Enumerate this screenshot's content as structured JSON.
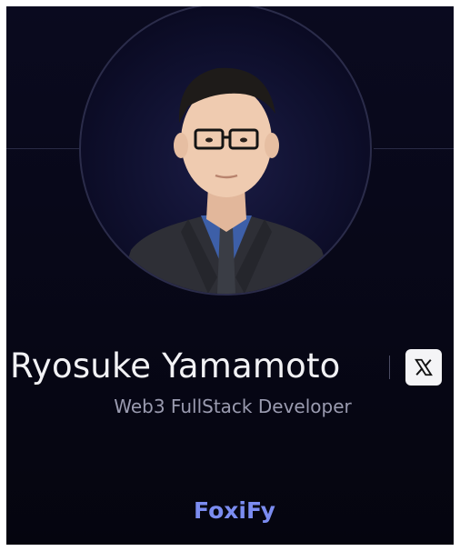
{
  "profile": {
    "name": "Ryosuke Yamamoto",
    "role": "Web3 FullStack Developer",
    "social_icon": "x-logo-icon"
  },
  "brand": {
    "label": "FoxiFy"
  },
  "colors": {
    "background": "#07071a",
    "brand": "#7b8cf0",
    "name": "#f2f2f5",
    "subtitle": "#9a9bb0"
  }
}
